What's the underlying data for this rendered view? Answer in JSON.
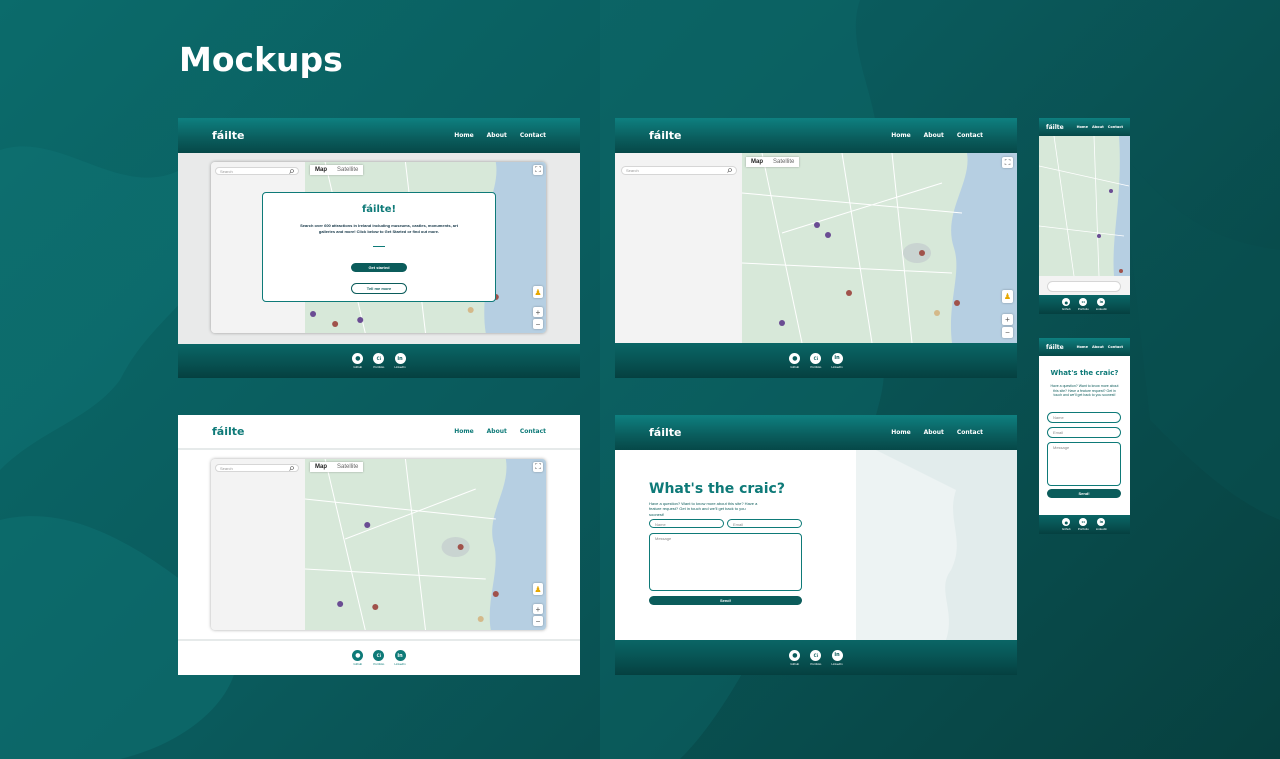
{
  "page": {
    "title": "Mockups"
  },
  "brand": {
    "logo": "fáilte"
  },
  "nav": {
    "home": "Home",
    "about": "About",
    "contact": "Contact"
  },
  "search": {
    "placeholder": "Search"
  },
  "map": {
    "map_label": "Map",
    "satellite_label": "Satellite"
  },
  "modal": {
    "title": "fáilte!",
    "body": "Search over 600 attractions in Ireland including museums, castles, monuments, art galleries and more! Click below to Get Started or find out more.",
    "primary": "Get started",
    "secondary": "Tell me more"
  },
  "contact": {
    "title": "What's the craic?",
    "subtitle": "Have a question? Want to know more about this site? Have a feature request? Get in touch and we'll get back to you soonest!",
    "name_placeholder": "Name",
    "email_placeholder": "Email",
    "message_placeholder": "Message",
    "send_label": "Send!"
  },
  "footer": {
    "github": "Github",
    "codeinstitute": "Portfolio",
    "linkedin": "LinkedIn",
    "ci_glyph": "Ci",
    "in_glyph": "in"
  },
  "colors": {
    "brand_dark": "#0a5c5c",
    "brand": "#0e7a78",
    "background": "#0a5a5c"
  }
}
